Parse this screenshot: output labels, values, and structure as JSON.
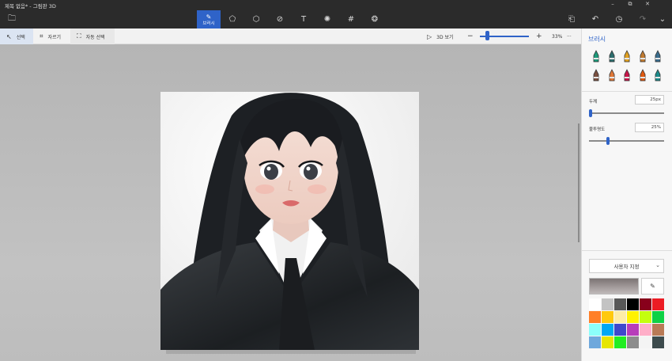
{
  "window": {
    "title": "제목 없음* - 그림판 3D",
    "min": "–",
    "max": "⧉",
    "close": "✕"
  },
  "toolbar": {
    "items": [
      {
        "name": "menu-icon",
        "glyph": "🗀"
      },
      {
        "name": "brushes-icon",
        "glyph": "✎",
        "label": "브러시"
      },
      {
        "name": "2d-shapes-icon",
        "glyph": "⬠"
      },
      {
        "name": "3d-shapes-icon",
        "glyph": "⬡"
      },
      {
        "name": "stickers-icon",
        "glyph": "⊘"
      },
      {
        "name": "text-icon",
        "glyph": "T"
      },
      {
        "name": "effects-icon",
        "glyph": "✺"
      },
      {
        "name": "canvas-icon",
        "glyph": "#"
      },
      {
        "name": "3d-library-icon",
        "glyph": "❂"
      }
    ],
    "right": [
      {
        "name": "paste-icon",
        "glyph": "⎗"
      },
      {
        "name": "undo-icon",
        "glyph": "↶"
      },
      {
        "name": "history-icon",
        "glyph": "◷"
      },
      {
        "name": "redo-icon",
        "glyph": "↷"
      },
      {
        "name": "expand-icon",
        "glyph": "⌄"
      }
    ]
  },
  "subtoolbar": {
    "select": "선택",
    "crop": "자르기",
    "magic_select": "자동 선택",
    "view3d": "3D 보기",
    "zoom_minus": "−",
    "zoom_plus": "+",
    "zoom_level": "33%",
    "more": "···"
  },
  "panel": {
    "title": "브러시",
    "thickness_label": "두께",
    "thickness_value": "25px",
    "opacity_label": "불투명도",
    "opacity_value": "25%",
    "color_dropdown": "사용자 지정",
    "brush_colors": [
      "#1c9a7a",
      "#2d6e6e",
      "#e0a020",
      "#c07a30",
      "#3a6c8c",
      "#7a5040",
      "#e07838",
      "#c8164a",
      "#e05a10",
      "#1c8a8a"
    ],
    "palette": [
      "#ffffff",
      "#c3c3c3",
      "#585858",
      "#000000",
      "#88001b",
      "#ec1c24",
      "#ff7f27",
      "#ffc90e",
      "#fdeca6",
      "#fff200",
      "#c4ff0e",
      "#0ed145",
      "#8cfffb",
      "#00a8f3",
      "#3f48cc",
      "#b83dba",
      "#ffaec8",
      "#b97a56",
      "#6fa8dc",
      "#e6e600",
      "#22ee22",
      "#8d8d8d",
      "#f4f4f4",
      "#3d4b4d"
    ]
  }
}
